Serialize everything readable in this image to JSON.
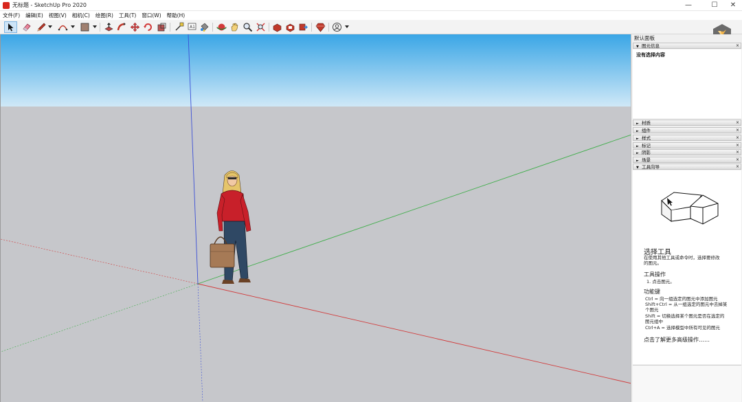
{
  "window": {
    "title": "无标题 - SketchUp Pro 2020",
    "controls": {
      "minimize": "—",
      "maximize": "☐",
      "close": "✕"
    }
  },
  "menu": [
    "文件(F)",
    "编辑(E)",
    "视图(V)",
    "相机(C)",
    "绘图(R)",
    "工具(T)",
    "窗口(W)",
    "帮助(H)"
  ],
  "toolbar": {
    "tools": [
      "select-icon",
      "eraser-icon",
      "pencil-icon",
      "arc-icon",
      "rectangle-icon",
      "push-pull-icon",
      "follow-me-icon",
      "move-icon",
      "rotate-icon",
      "scale-icon",
      "tape-measure-icon",
      "dimension-icon",
      "paint-bucket-icon",
      "orbit-icon",
      "pan-icon",
      "zoom-icon",
      "zoom-extents-icon",
      "3d-warehouse-icon",
      "extension-warehouse-icon",
      "send-to-layout-icon",
      "ruby-icon",
      "account-icon"
    ]
  },
  "panel": {
    "title": "默认面板",
    "entity_info": {
      "header": "图元信息",
      "body": "没有选择内容"
    },
    "trays": [
      "材质",
      "组件",
      "样式",
      "标记",
      "阴影",
      "场景"
    ],
    "instructor": {
      "header": "工具向导",
      "tool_name": "选择工具",
      "description_lines": [
        "在使用其他工具或命令时，选择要修改",
        "的图元。"
      ],
      "operations_title": "工具操作",
      "operations": [
        "1. 点击图元。"
      ],
      "modifiers_title": "功能键",
      "modifier_lines": [
        "Ctrl = 向一组选定的图元中添加图元",
        "Shift+Ctrl = 从一组选定的图元中去掉某",
        "个图元",
        "Shift = 切换选择某个图元是否在选定的",
        "图元组中",
        "Ctrl+A = 选择模型中所有可见的图元"
      ],
      "advanced_link": "点击了解更多高级操作……"
    }
  },
  "colors": {
    "sky_top": "#3aa6e6",
    "sky_bottom": "#cfe8f7",
    "ground": "#c6c7cb",
    "axis_red": "#d23a3a",
    "axis_green": "#3fae4a",
    "axis_blue": "#3b4fd6"
  }
}
